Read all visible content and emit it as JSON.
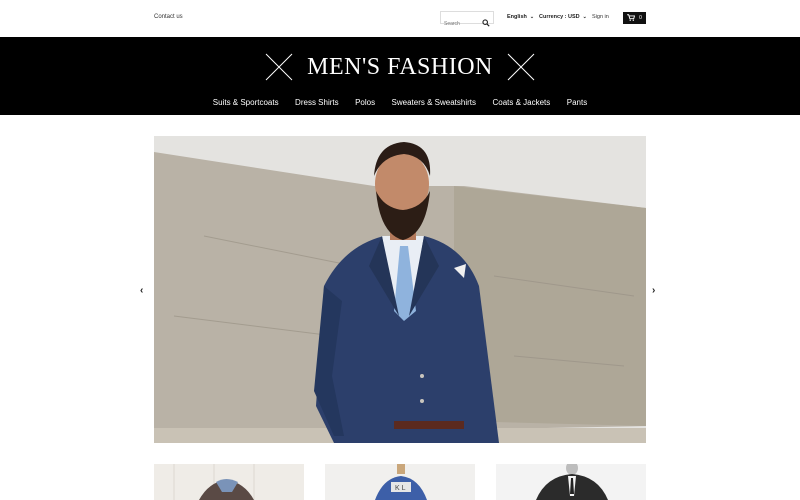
{
  "topbar": {
    "contact_label": "Contact us",
    "search_placeholder": "Search",
    "language": "English",
    "currency": "Currency : USD",
    "signin_label": "Sign in",
    "cart_count": "0"
  },
  "brand": {
    "title": "MEN'S FASHION"
  },
  "nav": {
    "items": [
      {
        "label": "Suits & Sportcoats"
      },
      {
        "label": "Dress Shirts"
      },
      {
        "label": "Polos"
      },
      {
        "label": "Sweaters & Sweatshirts"
      },
      {
        "label": "Coats & Jackets"
      },
      {
        "label": "Pants"
      }
    ]
  },
  "carousel": {
    "prev_glyph": "‹",
    "next_glyph": "›"
  },
  "icons": {
    "search": "search-icon",
    "cart": "cart-icon",
    "logo_mark": "crossed-lines-icon"
  },
  "colors": {
    "header_bg": "#000000",
    "header_text": "#ffffff",
    "suit": "#2c3f6b"
  }
}
